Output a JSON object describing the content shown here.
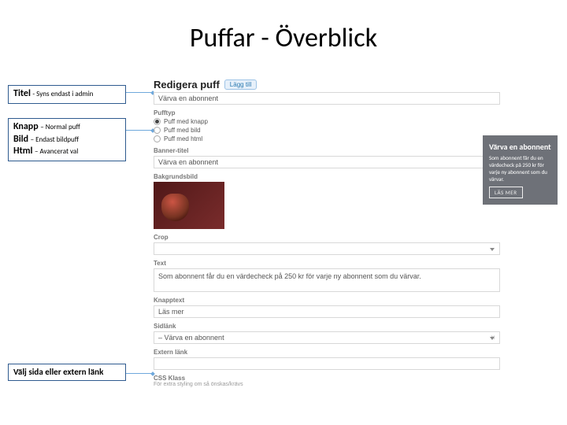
{
  "slide": {
    "title": "Puffar - Överblick"
  },
  "callouts": {
    "title": {
      "label": "Titel",
      "desc": "- Syns endast i admin"
    },
    "type": {
      "knapp_label": "Knapp",
      "knapp_desc": "– Normal puff",
      "bild_label": "Bild",
      "bild_desc": "– Endast bildpuff",
      "html_label": "Html",
      "html_desc": "– Avancerat val"
    },
    "link": {
      "text": "Välj sida eller extern länk"
    }
  },
  "admin": {
    "heading": "Redigera puff",
    "new_btn": "Lägg till",
    "title_value": "Värva en abonnent",
    "pufftype_label": "Pufftyp",
    "radio_options": [
      "Puff med knapp",
      "Puff med bild",
      "Puff med html"
    ],
    "banner_label": "Banner-titel",
    "banner_value": "Värva en abonnent",
    "bg_label": "Bakgrundsbild",
    "crop_label": "Crop",
    "text_label": "Text",
    "text_value": "Som abonnent får du en värdecheck på 250 kr för varje ny abonnent som du värvar.",
    "knapptext_label": "Knapptext",
    "knapptext_value": "Läs mer",
    "sidlank_label": "Sidlänk",
    "sidlank_value": "– Värva en abonnent",
    "externlank_label": "Extern länk",
    "css_label": "CSS Klass",
    "css_hint": "För extra styling om så önskas/krävs"
  },
  "preview": {
    "title": "Värva en abonnent",
    "body": "Som abonnent får du en värdecheck på 250 kr för varje ny abonnent som du värvar.",
    "button": "LÄS MER"
  }
}
